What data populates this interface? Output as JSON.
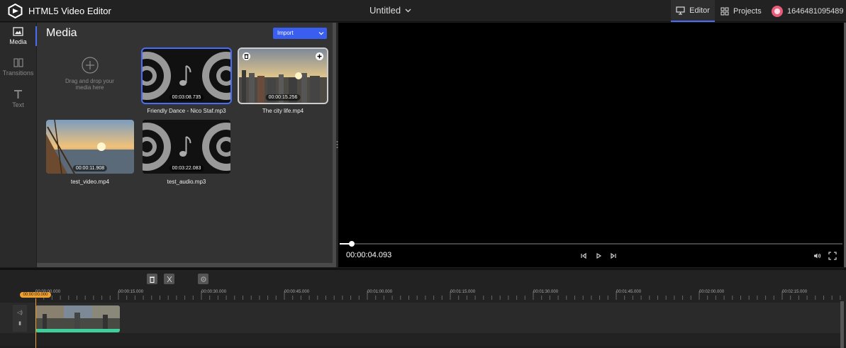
{
  "topbar": {
    "app_title": "HTML5 Video Editor",
    "project_title": "Untitled",
    "nav_editor": "Editor",
    "nav_projects": "Projects",
    "user_id": "1646481095489"
  },
  "sidebar": {
    "items": [
      {
        "label": "Media",
        "icon": "image-icon"
      },
      {
        "label": "Transitions",
        "icon": "transitions-icon"
      },
      {
        "label": "Text",
        "icon": "text-icon"
      }
    ]
  },
  "media": {
    "heading": "Media",
    "import_label": "Import",
    "drop_text_1": "Drag and drop your",
    "drop_text_2": "media here",
    "items": [
      {
        "name": "Friendly Dance - Nico Staf.mp3",
        "duration": "00:03:08.735",
        "kind": "audio"
      },
      {
        "name": "The city life.mp4",
        "duration": "00:00:15.256",
        "kind": "video"
      },
      {
        "name": "test_video.mp4",
        "duration": "00:00:11.908",
        "kind": "video"
      },
      {
        "name": "test_audio.mp3",
        "duration": "00:03:22.083",
        "kind": "audio"
      }
    ]
  },
  "preview": {
    "current_time": "00:00:04.093",
    "progress": 0.024
  },
  "timeline": {
    "playhead_time": "00:00:00.000",
    "ruler_labels": [
      "00:00:00.000",
      "00:00:15.000",
      "00:00:30.000",
      "00:00:45.000",
      "00:01:00.000",
      "00:01:15.000",
      "00:01:30.000",
      "00:01:45.000",
      "00:02:00.000",
      "00:02:15.000"
    ]
  },
  "colors": {
    "accent": "#4a6cf7",
    "playhead": "#f0a030",
    "clip_bar": "#3fcf9a"
  }
}
